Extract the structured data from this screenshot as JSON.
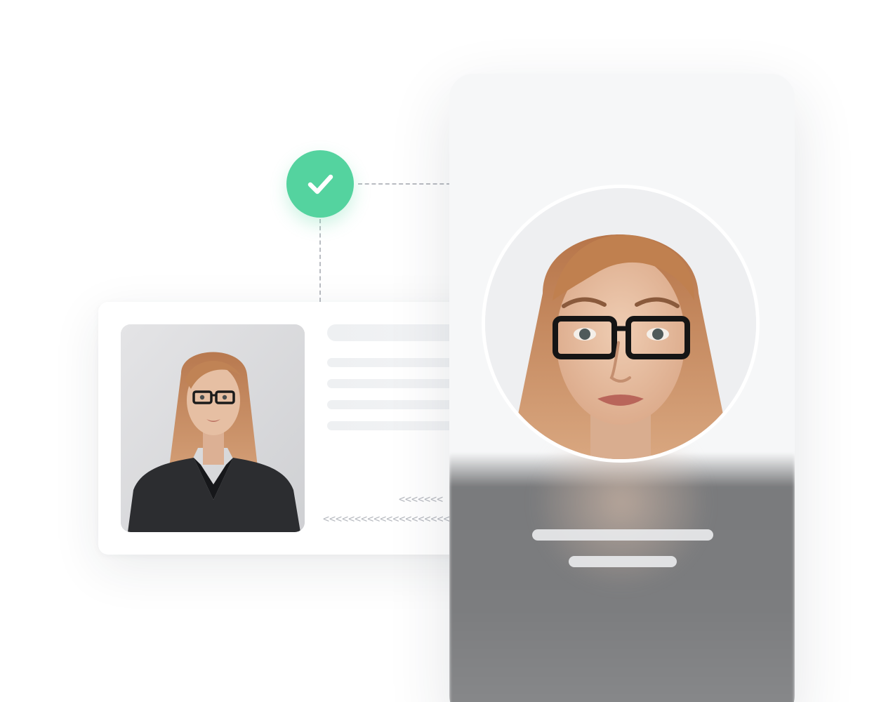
{
  "verification": {
    "status_icon": "check-icon",
    "accent_color": "#54d39f"
  },
  "id_document": {
    "portrait_icon": "portrait-photo",
    "mrz_line_1": "<<<<<<<",
    "mrz_line_2": "<<<<<<<<<<<<<<<<<<<<<<"
  },
  "selfie_screen": {
    "face_icon": "face-photo"
  },
  "colors": {
    "skeleton": "#eef0f2",
    "connector": "#b9bcc2",
    "hair": "#c08355",
    "skin": "#e6bfa3",
    "jacket": "#2c2d30"
  }
}
